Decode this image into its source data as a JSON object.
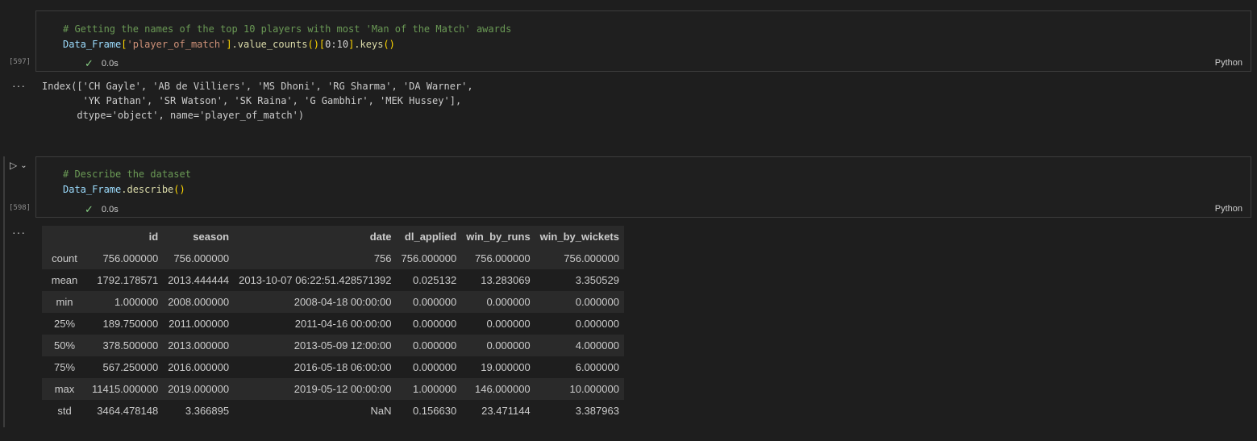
{
  "cell1": {
    "exec_count": "[597]",
    "code_line1": "# Getting the names of the top 10 players with most 'Man of the Match' awards",
    "code_var": "Data_Frame",
    "code_open": "[",
    "code_str": "'player_of_match'",
    "code_close": "]",
    "code_method": ".value_counts",
    "code_paren": "()",
    "code_slice_open": "[",
    "code_slice": "0:10",
    "code_slice_close": "]",
    "code_keys": ".keys",
    "code_keys_paren": "()",
    "status_time": "0.0s",
    "language": "Python",
    "output_lines": [
      "Index(['CH Gayle', 'AB de Villiers', 'MS Dhoni', 'RG Sharma', 'DA Warner',",
      "       'YK Pathan', 'SR Watson', 'SK Raina', 'G Gambhir', 'MEK Hussey'],",
      "      dtype='object', name='player_of_match')"
    ]
  },
  "cell2": {
    "exec_count": "[598]",
    "code_line1": "# Describe the dataset",
    "code_var": "Data_Frame",
    "code_method": ".describe",
    "code_paren": "()",
    "status_time": "0.0s",
    "language": "Python",
    "table": {
      "columns": [
        "",
        "id",
        "season",
        "date",
        "dl_applied",
        "win_by_runs",
        "win_by_wickets"
      ],
      "rows": [
        [
          "count",
          "756.000000",
          "756.000000",
          "756",
          "756.000000",
          "756.000000",
          "756.000000"
        ],
        [
          "mean",
          "1792.178571",
          "2013.444444",
          "2013-10-07 06:22:51.428571392",
          "0.025132",
          "13.283069",
          "3.350529"
        ],
        [
          "min",
          "1.000000",
          "2008.000000",
          "2008-04-18 00:00:00",
          "0.000000",
          "0.000000",
          "0.000000"
        ],
        [
          "25%",
          "189.750000",
          "2011.000000",
          "2011-04-16 00:00:00",
          "0.000000",
          "0.000000",
          "0.000000"
        ],
        [
          "50%",
          "378.500000",
          "2013.000000",
          "2013-05-09 12:00:00",
          "0.000000",
          "0.000000",
          "4.000000"
        ],
        [
          "75%",
          "567.250000",
          "2016.000000",
          "2016-05-18 06:00:00",
          "0.000000",
          "19.000000",
          "6.000000"
        ],
        [
          "max",
          "11415.000000",
          "2019.000000",
          "2019-05-12 00:00:00",
          "1.000000",
          "146.000000",
          "10.000000"
        ],
        [
          "std",
          "3464.478148",
          "3.366895",
          "NaN",
          "0.156630",
          "23.471144",
          "3.387963"
        ]
      ]
    }
  },
  "icons": {
    "check": "✓",
    "more": "···",
    "run": "▷",
    "chevron": "⌄"
  }
}
